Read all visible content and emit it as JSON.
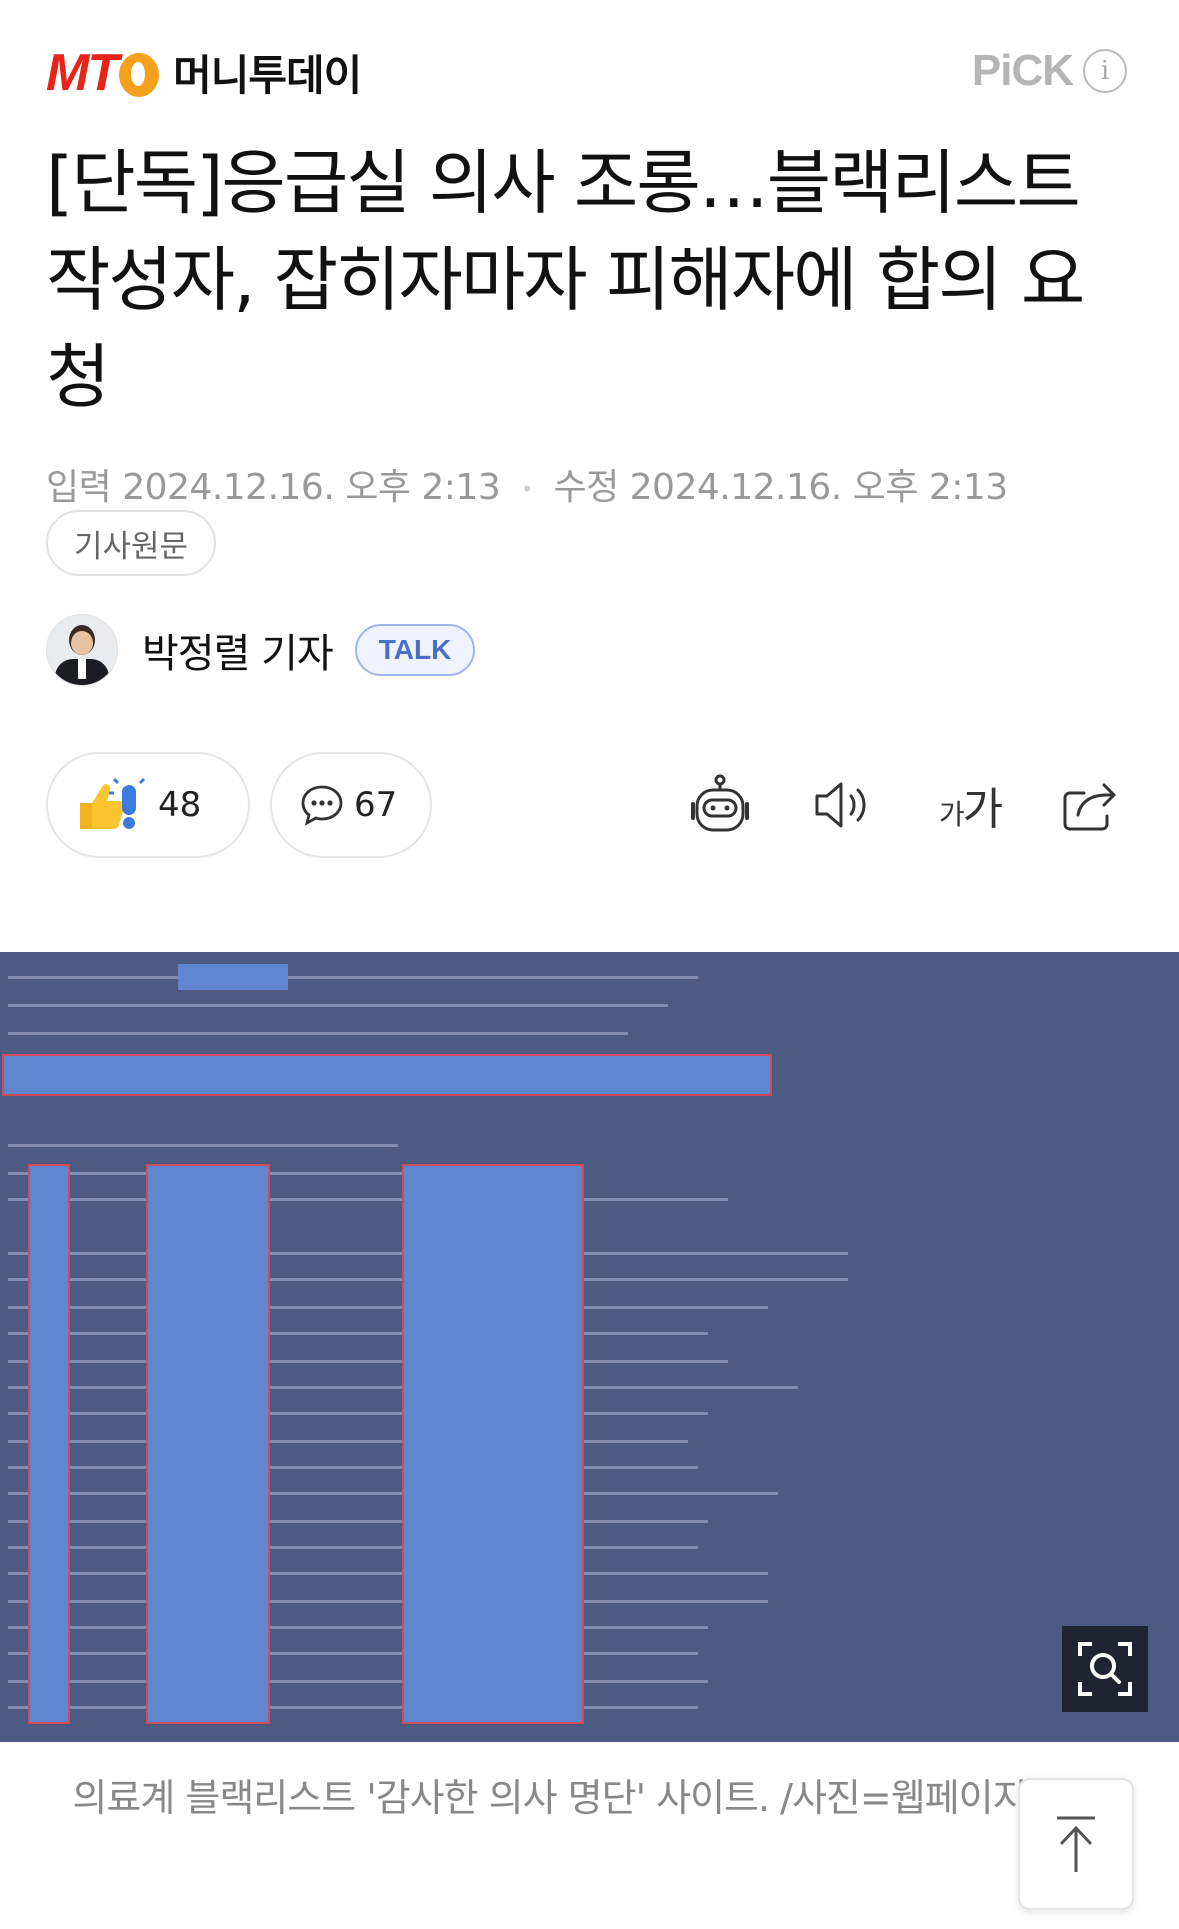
{
  "header": {
    "logo_mt": "MT",
    "logo_korean": "머니투데이",
    "pick_label": "PiCK",
    "info_glyph": "i"
  },
  "article": {
    "title": "[단독]응급실 의사 조롱…블랙리스트 작성자, 잡히자마자 피해자에 합의 요청",
    "input_label": "입력",
    "input_date": "2024.12.16. 오후 2:13",
    "modified_label": "수정",
    "modified_date": "2024.12.16. 오후 2:13",
    "original_button": "기사원문"
  },
  "author": {
    "name": "박정렬 기자",
    "talk_label": "TALK"
  },
  "reactions": {
    "like_count": "48",
    "comment_count": "67"
  },
  "toolbar": {
    "icons": [
      "summary-bot-icon",
      "speaker-icon",
      "font-size-icon",
      "share-icon"
    ],
    "font_size_small": "가",
    "font_size_large": "가"
  },
  "photo": {
    "caption": "의료계 블랙리스트 '감사한 의사 명단' 사이트. /사진=웹페이지 캡처"
  },
  "colors": {
    "brand_red": "#e8231a",
    "brand_orange": "#f4a21d",
    "talk_blue": "#4b6fc4",
    "photo_bg": "#4d5a82"
  }
}
